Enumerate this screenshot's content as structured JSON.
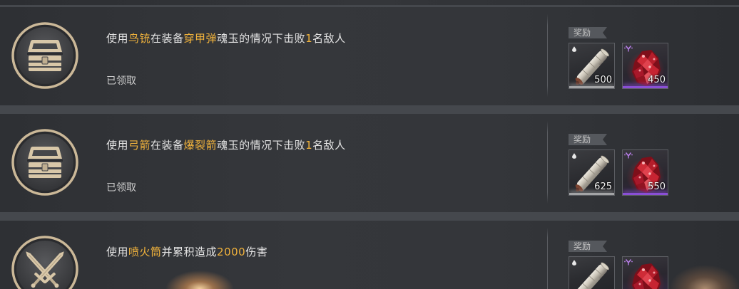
{
  "colors": {
    "highlight": "#f0b23c",
    "text": "#e4e4e4",
    "muted": "#cdcdcd",
    "ring": "#cbb898"
  },
  "quests": [
    {
      "icon": "chest-icon",
      "title": [
        {
          "text": "使用",
          "highlight": false
        },
        {
          "text": "鸟铳",
          "highlight": true
        },
        {
          "text": "在装备",
          "highlight": false
        },
        {
          "text": "穿甲弹",
          "highlight": true
        },
        {
          "text": "魂玉的情况下击败",
          "highlight": false
        },
        {
          "text": "1",
          "highlight": true
        },
        {
          "text": "名敌人",
          "highlight": false
        }
      ],
      "status": "已领取",
      "reward_label": "奖励",
      "rewards": [
        {
          "item": "scroll-icon",
          "badge": "drop-icon",
          "amount": 500,
          "bar_color": "#a3a4a6"
        },
        {
          "item": "red-crystal-icon",
          "badge": "purple-rune-icon",
          "amount": 450,
          "bar_color": "#8a4fd6"
        }
      ]
    },
    {
      "icon": "chest-icon",
      "title": [
        {
          "text": "使用",
          "highlight": false
        },
        {
          "text": "弓箭",
          "highlight": true
        },
        {
          "text": "在装备",
          "highlight": false
        },
        {
          "text": "爆裂箭",
          "highlight": true
        },
        {
          "text": "魂玉的情况下击败",
          "highlight": false
        },
        {
          "text": "1",
          "highlight": true
        },
        {
          "text": "名敌人",
          "highlight": false
        }
      ],
      "status": "已领取",
      "reward_label": "奖励",
      "rewards": [
        {
          "item": "scroll-icon",
          "badge": "drop-icon",
          "amount": 625,
          "bar_color": "#a3a4a6"
        },
        {
          "item": "red-crystal-icon",
          "badge": "purple-rune-icon",
          "amount": 550,
          "bar_color": "#8a4fd6"
        }
      ]
    },
    {
      "icon": "crossed-swords-icon",
      "title": [
        {
          "text": "使用",
          "highlight": false
        },
        {
          "text": "喷火筒",
          "highlight": true
        },
        {
          "text": "并累积造成",
          "highlight": false
        },
        {
          "text": "2000",
          "highlight": true
        },
        {
          "text": "伤害",
          "highlight": false
        }
      ],
      "reward_label": "奖励",
      "rewards": [
        {
          "item": "scroll-icon",
          "badge": "drop-icon"
        },
        {
          "item": "red-crystal-icon",
          "badge": "purple-rune-icon"
        }
      ]
    }
  ]
}
